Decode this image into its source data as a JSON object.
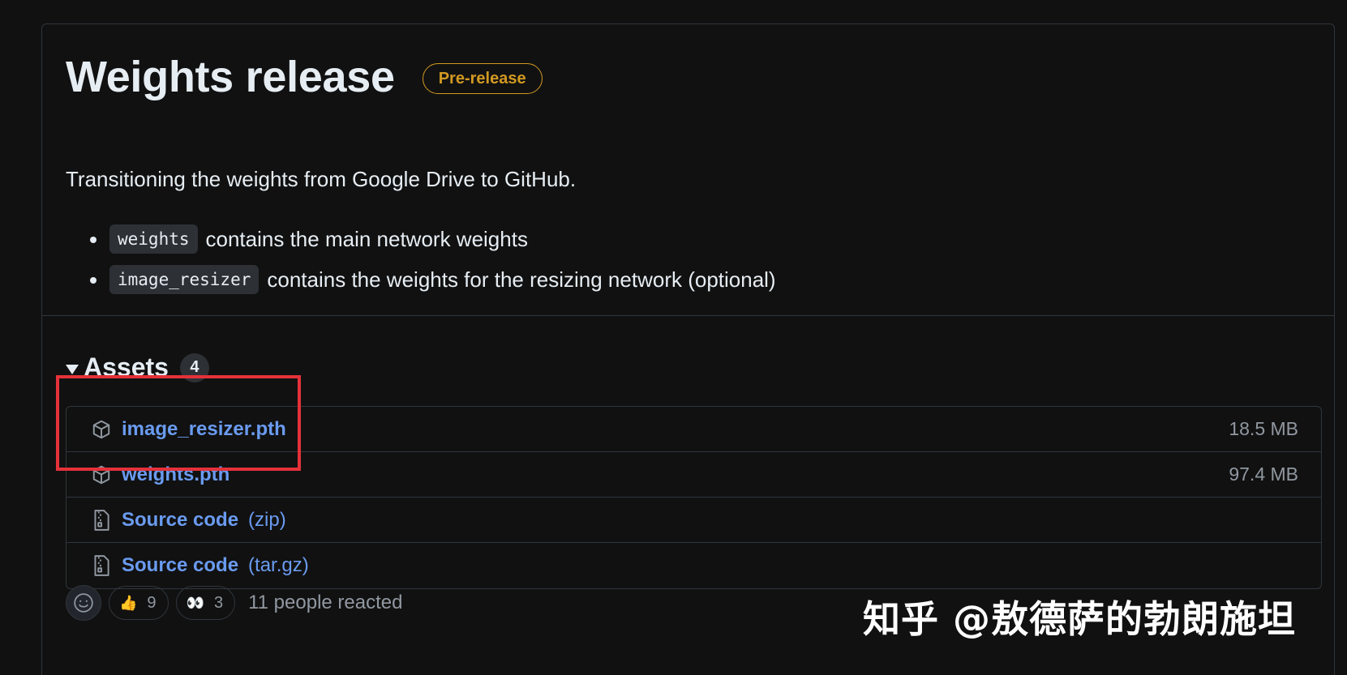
{
  "release": {
    "title": "Weights release",
    "badge": "Pre-release",
    "description": "Transitioning the weights from Google Drive to GitHub.",
    "bullets": [
      {
        "code": "weights",
        "text": "contains the main network weights"
      },
      {
        "code": "image_resizer",
        "text": "contains the weights for the resizing network (optional)"
      }
    ]
  },
  "assets": {
    "title": "Assets",
    "count": "4",
    "items": [
      {
        "name": "image_resizer.pth",
        "suffix": "",
        "size": "18.5 MB",
        "icon": "package-icon"
      },
      {
        "name": "weights.pth",
        "suffix": "",
        "size": "97.4 MB",
        "icon": "package-icon"
      },
      {
        "name": "Source code",
        "suffix": "(zip)",
        "size": "",
        "icon": "file-zip-icon"
      },
      {
        "name": "Source code",
        "suffix": "(tar.gz)",
        "size": "",
        "icon": "file-zip-icon"
      }
    ]
  },
  "reactions": {
    "items": [
      {
        "emoji": "👍",
        "count": "9",
        "icon": "thumbs-up-icon"
      },
      {
        "emoji": "👀",
        "count": "3",
        "icon": "eyes-icon"
      }
    ],
    "summary": "11 people reacted"
  },
  "watermark": "知乎 @敖德萨的勃朗施坦",
  "colors": {
    "background": "#111111",
    "link": "#6a9bf0",
    "prerelease": "#d29922",
    "highlight": "#e5313a"
  }
}
